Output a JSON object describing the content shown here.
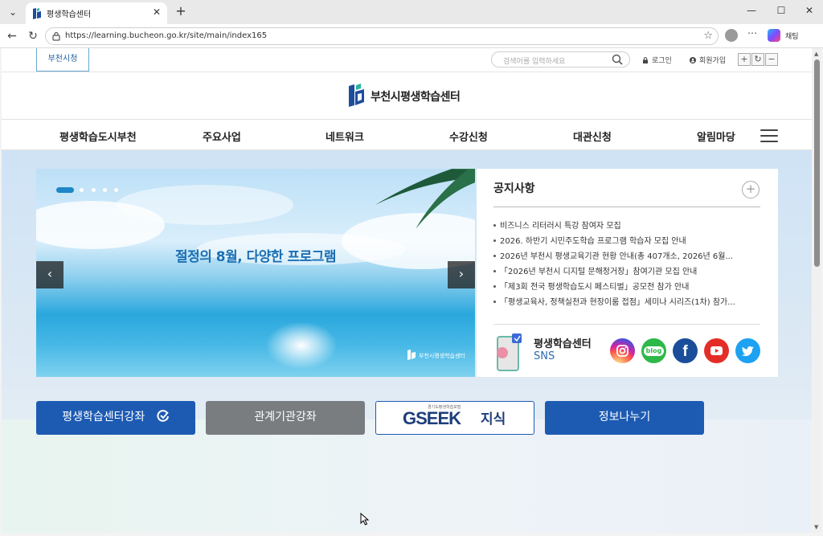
{
  "browser": {
    "tab_title": "평생학습센터",
    "url": "https://learning.bucheon.go.kr/site/main/index165",
    "chat_label": "채팅",
    "window_controls": {
      "minimize": "—",
      "maximize": "☐",
      "close": "✕"
    }
  },
  "util": {
    "city_tab": "부천시청",
    "search_placeholder": "검색어를 입력하세요",
    "login": "로그인",
    "signup": "회원가입",
    "font_plus": "+",
    "font_reset": "↻",
    "font_minus": "−"
  },
  "logo": {
    "text": "부천시평생학습센터"
  },
  "gnb": {
    "items": [
      "평생학습도시부천",
      "주요사업",
      "네트워크",
      "수강신청",
      "대관신청",
      "알림마당"
    ]
  },
  "banner": {
    "title": "절정의 8월, 다양한 프로그램",
    "watermark": "부천시평생학습센터",
    "prev": "‹",
    "next": "›"
  },
  "notice": {
    "title": "공지사항",
    "more": "+",
    "items": [
      "비즈니스 리터러시 특강 참여자 모집",
      "2026. 하반기 시민주도학습 프로그램 학습자 모집 안내",
      "2026년 부천시 평생교육기관 현황 안내(총 407개소, 2026년 6월...",
      "「2026년 부천시 디지털 문해정거장」참여기관 모집 안내",
      "「제3회 전국 평생학습도시 페스티벌」공모전 참가 안내",
      "「평생교육사, 정책실천과 현장이룸 접점」세미나 시리즈(1차) 참가..."
    ],
    "sns_title": "평생학습센터",
    "sns_sub": "SNS",
    "sns": [
      {
        "name": "instagram",
        "color": "#d6249f"
      },
      {
        "name": "blog",
        "color": "#2fb84a",
        "label": "blog"
      },
      {
        "name": "facebook",
        "color": "#1a4e9b",
        "label": "f"
      },
      {
        "name": "youtube",
        "color": "#e52d27"
      },
      {
        "name": "twitter",
        "color": "#1da1f2"
      }
    ]
  },
  "quick": {
    "btn1": "평생학습센터강좌",
    "btn2": "관계기관강좌",
    "btn3_small": "경기도평생학습포털",
    "btn3_logo": "GSEEK",
    "btn3_suffix": "지식",
    "btn4": "정보나누기"
  },
  "colors": {
    "brand_blue": "#1d5bb3",
    "gray_button": "#7a7d80"
  }
}
